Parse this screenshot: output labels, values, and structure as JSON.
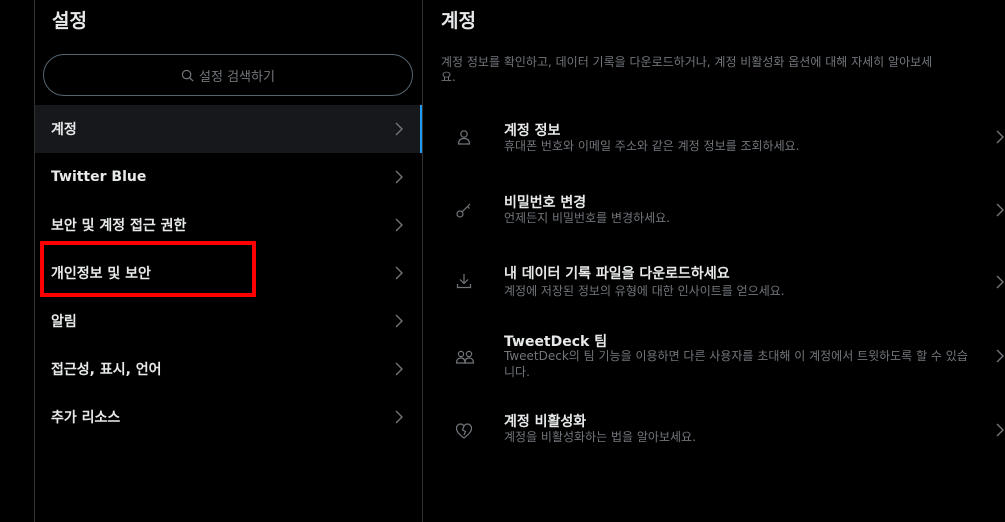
{
  "settings": {
    "title": "설정",
    "search_placeholder": "설정 검색하기",
    "items": [
      {
        "label": "계정",
        "active": true
      },
      {
        "label": "Twitter Blue"
      },
      {
        "label": "보안 및 계정 접근 권한"
      },
      {
        "label": "개인정보 및 보안"
      },
      {
        "label": "알림"
      },
      {
        "label": "접근성, 표시, 언어"
      },
      {
        "label": "추가 리소스"
      }
    ]
  },
  "account": {
    "title": "계정",
    "description_line1": "계정 정보를 확인하고, 데이터 기록을 다운로드하거나, 계정 비활성화 옵션에 대해 자세히 알아보세",
    "description_line2": "요.",
    "items": [
      {
        "label": "계정 정보",
        "sub": "휴대폰 번호와 이메일 주소와 같은 계정 정보를 조회하세요.",
        "icon": "person-icon"
      },
      {
        "label": "비밀번호 변경",
        "sub": "언제든지 비밀번호를 변경하세요.",
        "icon": "key-icon"
      },
      {
        "label": "내 데이터 기록 파일을 다운로드하세요",
        "sub": "계정에 저장된 정보의 유형에 대한 인사이트를 얻으세요.",
        "icon": "download-icon"
      },
      {
        "label": "TweetDeck 팀",
        "sub": "TweetDeck의 팀 기능을 이용하면 다른 사용자를 초대해 이 계정에서 트윗하도록 할 수 있습니다.",
        "icon": "people-icon"
      },
      {
        "label": "계정 비활성화",
        "sub": "계정을 비활성화하는 법을 알아보세요.",
        "icon": "broken-heart-icon"
      }
    ]
  },
  "colors": {
    "background": "#000000",
    "text": "#e7e9ea",
    "secondary_text": "#71767b",
    "accent": "#1d9bf0",
    "highlight": "#ff0000"
  }
}
